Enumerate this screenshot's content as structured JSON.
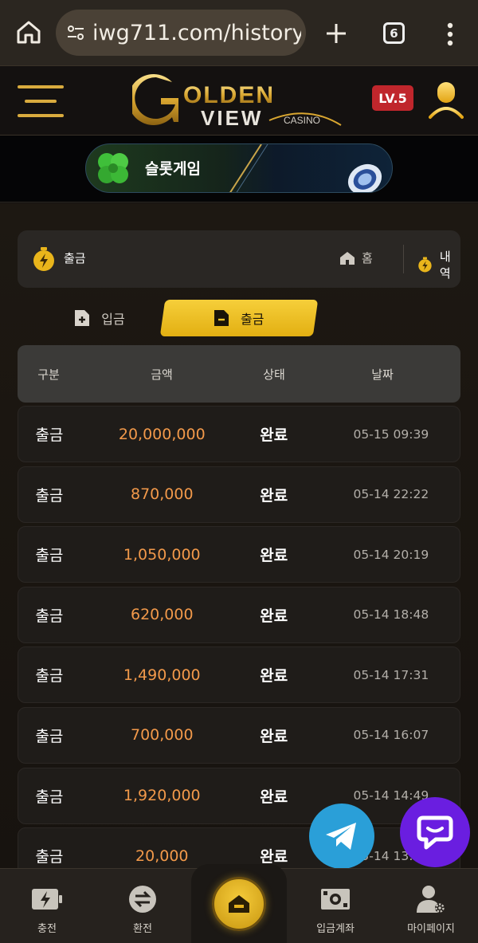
{
  "browser": {
    "url": "iwg711.com/history/",
    "tab_count": "6"
  },
  "header": {
    "logo_text": "GOLDEN VIEW",
    "logo_subtext": "CASINO",
    "level_badge": "LV.5"
  },
  "banner": {
    "label": "슬롯게임"
  },
  "breadcrumb": {
    "title": "출금",
    "home_label": "홈",
    "history_label": "내역"
  },
  "tabs": [
    {
      "label": "입금",
      "active": false
    },
    {
      "label": "출금",
      "active": true
    }
  ],
  "table": {
    "headers": [
      "구분",
      "금액",
      "상태",
      "날짜"
    ],
    "rows": [
      {
        "type": "출금",
        "amount": "20,000,000",
        "status": "완료",
        "date": "05-15 09:39"
      },
      {
        "type": "출금",
        "amount": "870,000",
        "status": "완료",
        "date": "05-14 22:22"
      },
      {
        "type": "출금",
        "amount": "1,050,000",
        "status": "완료",
        "date": "05-14 20:19"
      },
      {
        "type": "출금",
        "amount": "620,000",
        "status": "완료",
        "date": "05-14 18:48"
      },
      {
        "type": "출금",
        "amount": "1,490,000",
        "status": "완료",
        "date": "05-14 17:31"
      },
      {
        "type": "출금",
        "amount": "700,000",
        "status": "완료",
        "date": "05-14 16:07"
      },
      {
        "type": "출금",
        "amount": "1,920,000",
        "status": "완료",
        "date": "05-14 14:49"
      },
      {
        "type": "출금",
        "amount": "20,000",
        "status": "완료",
        "date": "05-14 13:39"
      }
    ]
  },
  "bottom_nav": {
    "charge": "충전",
    "exchange": "환전",
    "deposit_account": "입금계좌",
    "my_page": "마이페이지"
  },
  "colors": {
    "accent_gold": "#e9b51b",
    "amount_orange": "#f2994a",
    "level_red": "#c0262c",
    "telegram_blue": "#2a9fd8",
    "chat_purple": "#6a1ee0"
  }
}
